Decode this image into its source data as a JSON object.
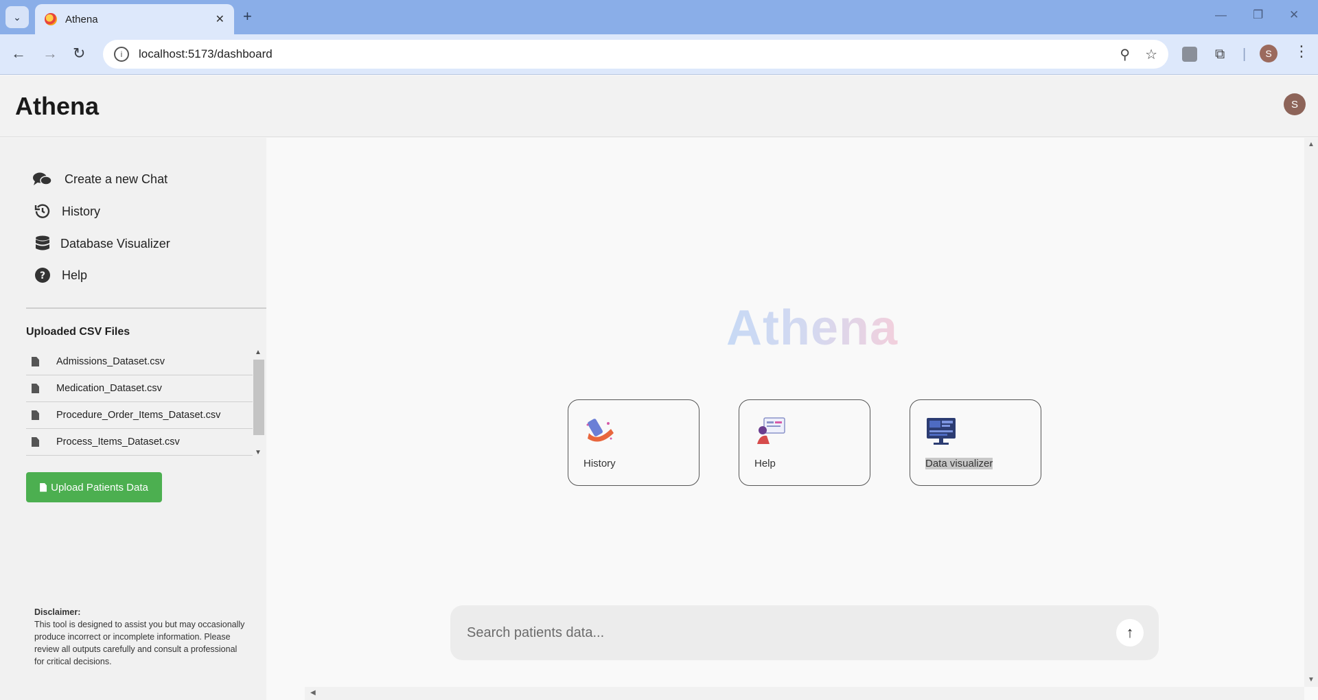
{
  "browser": {
    "tab_title": "Athena",
    "url": "localhost:5173/dashboard",
    "profile_initial": "S"
  },
  "header": {
    "brand": "Athena",
    "user_initial": "S"
  },
  "sidebar": {
    "items": [
      {
        "label": "Create a new Chat",
        "icon": "comments-icon"
      },
      {
        "label": "History",
        "icon": "history-icon"
      },
      {
        "label": "Database Visualizer",
        "icon": "database-icon"
      },
      {
        "label": "Help",
        "icon": "help-circle-icon"
      }
    ],
    "csv_heading": "Uploaded CSV Files",
    "csv_files": [
      "Admissions_Dataset.csv",
      "Medication_Dataset.csv",
      "Procedure_Order_Items_Dataset.csv",
      "Process_Items_Dataset.csv"
    ],
    "upload_label": "Upload Patients Data",
    "disclaimer_title": "Disclaimer:",
    "disclaimer_text": "This tool is designed to assist you but may occasionally produce incorrect or incomplete information. Please review all outputs carefully and consult a professional for critical decisions."
  },
  "main": {
    "hero_title": "Athena",
    "cards": [
      {
        "label": "History",
        "icon": "history-illustration-icon"
      },
      {
        "label": "Help",
        "icon": "help-illustration-icon"
      },
      {
        "label": "Data visualizer",
        "icon": "data-visualizer-illustration-icon"
      }
    ],
    "search_placeholder": "Search patients data..."
  },
  "colors": {
    "upload_button": "#4caf50",
    "browser_frame": "#8aaee8"
  }
}
